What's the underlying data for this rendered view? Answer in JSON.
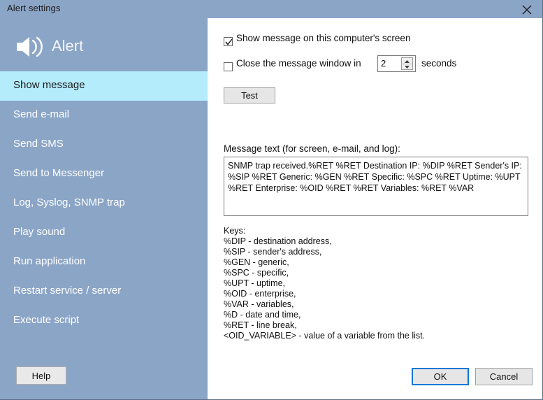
{
  "window": {
    "title": "Alert settings",
    "close_icon": "close-icon"
  },
  "sidebar": {
    "brand": {
      "label": "Alert",
      "icon": "speaker-volume-icon"
    },
    "items": [
      {
        "label": "Show message",
        "active": true
      },
      {
        "label": "Send e-mail",
        "active": false
      },
      {
        "label": "Send SMS",
        "active": false
      },
      {
        "label": "Send to Messenger",
        "active": false
      },
      {
        "label": "Log, Syslog, SNMP trap",
        "active": false
      },
      {
        "label": "Play sound",
        "active": false
      },
      {
        "label": "Run application",
        "active": false
      },
      {
        "label": "Restart service / server",
        "active": false
      },
      {
        "label": "Execute script",
        "active": false
      }
    ],
    "help_label": "Help"
  },
  "main": {
    "show_message": {
      "label": "Show message on this computer's screen",
      "checked": true
    },
    "close_window": {
      "label": "Close the message window in",
      "checked": false
    },
    "seconds": {
      "value": "2",
      "unit_label": "seconds",
      "up_icon": "chevron-up-icon",
      "down_icon": "chevron-down-icon"
    },
    "test_label": "Test",
    "message": {
      "label": "Message text (for screen, e-mail, and log):",
      "value": "SNMP trap received.%RET %RET Destination IP: %DIP %RET Sender's IP: %SIP %RET Generic: %GEN %RET Specific: %SPC %RET Uptime: %UPT %RET Enterprise: %OID %RET %RET Variables: %RET %VAR"
    },
    "keys": {
      "title": "Keys:",
      "lines": [
        "%DIP - destination address,",
        "%SIP - sender's address,",
        "%GEN - generic,",
        "%SPC - specific,",
        "%UPT - uptime,",
        "%OID - enterprise,",
        "%VAR - variables,",
        "%D - date and time,",
        "%RET - line break,",
        "<OID_VARIABLE> - value of a variable from the list."
      ]
    },
    "ok_label": "OK",
    "cancel_label": "Cancel"
  },
  "colors": {
    "title_bar": "#8ba5c7",
    "sidebar": "#8ba5c7",
    "active_item": "#b5ecfc",
    "accent_focus": "#0078d7",
    "panel": "#ffffff"
  }
}
